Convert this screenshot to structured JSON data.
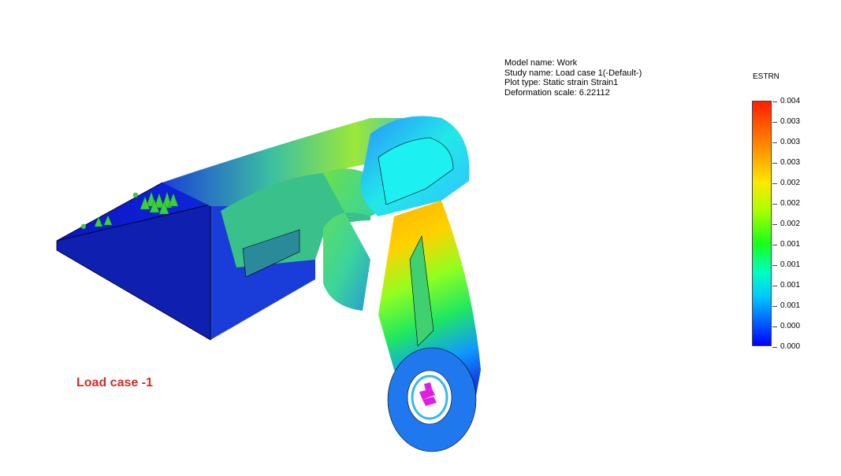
{
  "plot_info": {
    "model_name": "Model name: Work",
    "study_name": "Study name: Load case 1(-Default-)",
    "plot_type": "Plot type: Static strain Strain1",
    "deformation_scale": "Deformation scale: 6.22112"
  },
  "legend": {
    "title": "ESTRN",
    "labels": [
      "0.004",
      "0.003",
      "0.003",
      "0.003",
      "0.002",
      "0.002",
      "0.002",
      "0.001",
      "0.001",
      "0.001",
      "0.001",
      "0.000",
      "0.000"
    ],
    "colors": {
      "max": "#ff1e00",
      "mid": "#18ff18",
      "min": "#0000ff"
    }
  },
  "caption": "Load case -1",
  "colors": {
    "caption": "#d42a2a",
    "fixture_arrows": "#39d039",
    "load_arrows": "#e01ee0"
  }
}
